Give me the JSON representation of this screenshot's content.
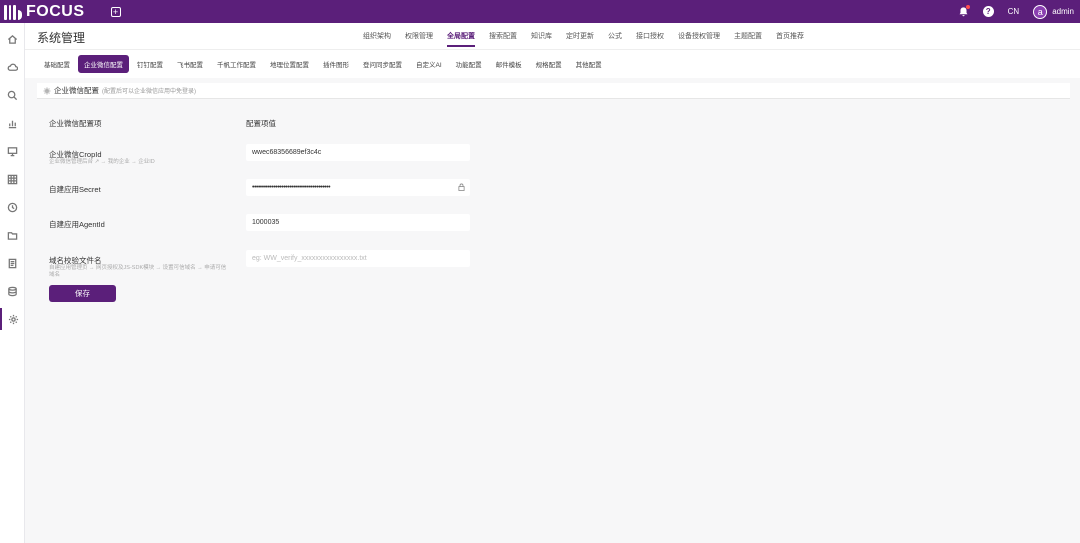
{
  "app": {
    "logo_text": "FOCUS"
  },
  "topbar": {
    "lang": "CN",
    "user_initial": "a",
    "username": "admin",
    "help_glyph": "?"
  },
  "colors": {
    "brand": "#5b1f7a",
    "notify_dot": "#ff4d4f"
  },
  "header": {
    "title": "系统管理",
    "tabs": [
      {
        "label": "组织架构"
      },
      {
        "label": "权限管理"
      },
      {
        "label": "全局配置",
        "active": true
      },
      {
        "label": "搜索配置"
      },
      {
        "label": "知识库"
      },
      {
        "label": "定时更新"
      },
      {
        "label": "公式"
      },
      {
        "label": "接口授权"
      },
      {
        "label": "设备授权管理"
      },
      {
        "label": "主题配置"
      },
      {
        "label": "首页推荐"
      }
    ]
  },
  "subtabs": [
    {
      "label": "基础配置"
    },
    {
      "label": "企业微信配置",
      "active": true
    },
    {
      "label": "钉钉配置"
    },
    {
      "label": "飞书配置"
    },
    {
      "label": "千帆工作配置"
    },
    {
      "label": "地理位置配置"
    },
    {
      "label": "插件图形"
    },
    {
      "label": "登问同步配置"
    },
    {
      "label": "自定义AI"
    },
    {
      "label": "功能配置"
    },
    {
      "label": "邮件模板"
    },
    {
      "label": "规格配置"
    },
    {
      "label": "其他配置"
    }
  ],
  "panel": {
    "title": "企业微信配置",
    "hint": "(配置后可以企业微信应用中免登录)",
    "col_item": "企业微信配置项",
    "col_value": "配置项值",
    "rows": {
      "corp_id": {
        "label": "企业微信CropId",
        "sub": "企业微信管理后台 ↗ → 我的企业 → 企业ID",
        "value": "wwec68356689ef3c4c"
      },
      "secret": {
        "label": "自建应用Secret",
        "value": "••••••••••••••••••••••••••••••••••••••••"
      },
      "agent_id": {
        "label": "自建应用AgentId",
        "value": "1000035"
      },
      "verify_file": {
        "label": "域名校验文件名",
        "sub": "自建应用管理页 → 网页授权及JS-SDK模块 → 设置可信域名 → 申请可信域名",
        "placeholder": "eg: WW_verify_xxxxxxxxxxxxxxxx.txt"
      }
    },
    "save_label": "保存"
  }
}
